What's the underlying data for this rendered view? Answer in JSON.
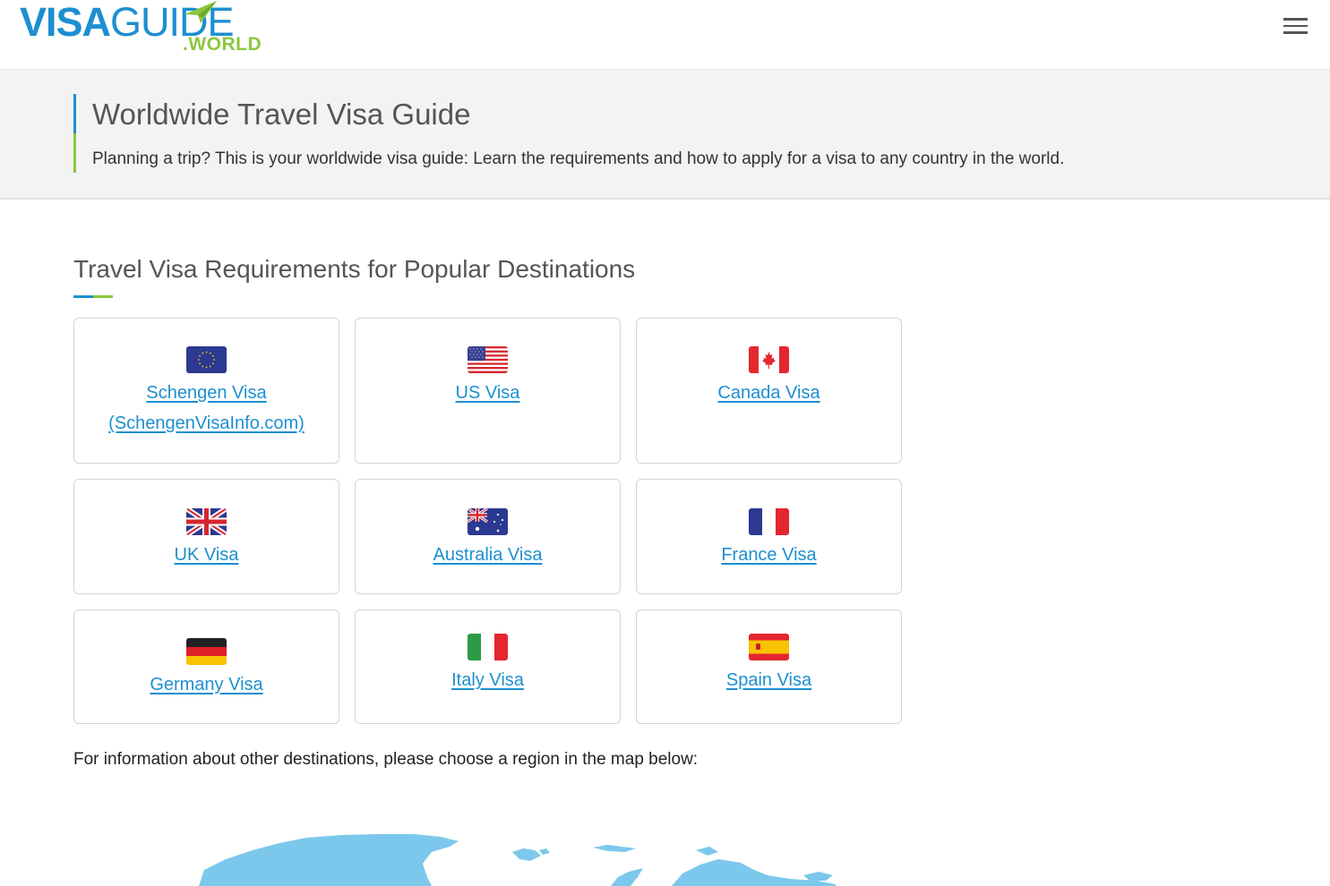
{
  "header": {
    "logo": {
      "part1": "VISA",
      "part2": "GUI",
      "part3": "DE",
      "suffix": ".WORLD"
    },
    "menu_icon": "hamburger-icon"
  },
  "banner": {
    "title": "Worldwide Travel Visa Guide",
    "subtitle": "Planning a trip? This is your worldwide visa guide: Learn the requirements and how to apply for a visa to any country in the world."
  },
  "popular": {
    "title": "Travel Visa Requirements for Popular Destinations",
    "cards": [
      {
        "label_line1": "Schengen Visa",
        "label_line2": "(SchengenVisaInfo.com)",
        "flag": "eu-flag-icon"
      },
      {
        "label": "US Visa",
        "flag": "us-flag-icon"
      },
      {
        "label": "Canada Visa",
        "flag": "canada-flag-icon"
      },
      {
        "label": "UK Visa",
        "flag": "uk-flag-icon"
      },
      {
        "label": "Australia Visa",
        "flag": "australia-flag-icon"
      },
      {
        "label": "France Visa",
        "flag": "france-flag-icon"
      },
      {
        "label": "Germany Visa",
        "flag": "germany-flag-icon"
      },
      {
        "label": "Italy Visa",
        "flag": "italy-flag-icon"
      },
      {
        "label": "Spain Visa",
        "flag": "spain-flag-icon"
      }
    ],
    "other_destinations_text": "For information about other destinations, please choose a region in the map below:"
  },
  "colors": {
    "brand_blue": "#1d8fd0",
    "brand_green": "#8cc63f",
    "map_blue": "#7cc8ec"
  }
}
